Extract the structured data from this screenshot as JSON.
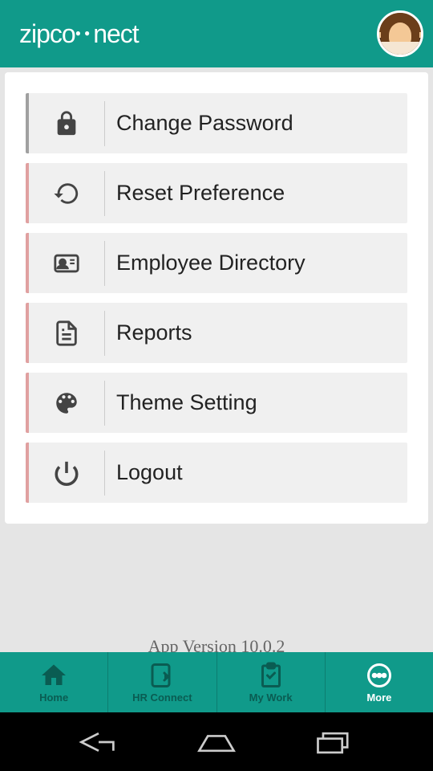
{
  "header": {
    "logo_text": "zipconnect"
  },
  "menu": {
    "items": [
      {
        "icon": "lock-icon",
        "label": "Change Password"
      },
      {
        "icon": "reset-icon",
        "label": "Reset Preference"
      },
      {
        "icon": "directory-icon",
        "label": "Employee Directory"
      },
      {
        "icon": "reports-icon",
        "label": "Reports"
      },
      {
        "icon": "theme-icon",
        "label": "Theme Setting"
      },
      {
        "icon": "power-icon",
        "label": "Logout"
      }
    ]
  },
  "version_text": "App Version 10.0.2",
  "bottom_nav": {
    "items": [
      {
        "icon": "home-icon",
        "label": "Home",
        "active": false
      },
      {
        "icon": "hr-connect-icon",
        "label": "HR Connect",
        "active": false
      },
      {
        "icon": "my-work-icon",
        "label": "My Work",
        "active": false
      },
      {
        "icon": "more-icon",
        "label": "More",
        "active": true
      }
    ]
  }
}
